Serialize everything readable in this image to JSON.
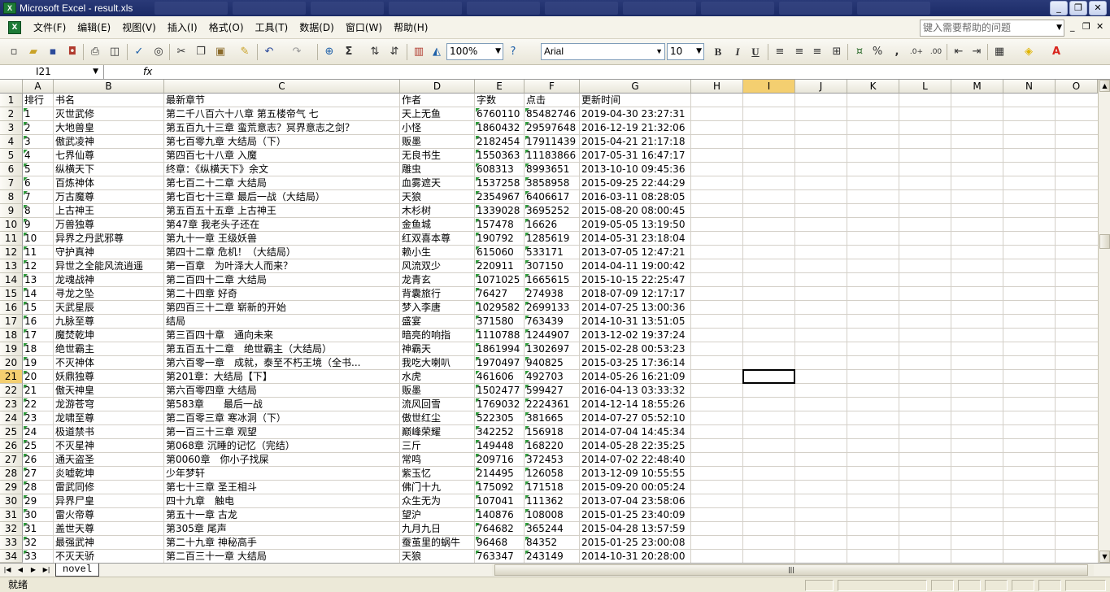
{
  "window": {
    "title": "Microsoft Excel - result.xls",
    "minimize": "_",
    "restore": "❐",
    "close": "✕"
  },
  "menu": {
    "items": [
      "文件(F)",
      "编辑(E)",
      "视图(V)",
      "插入(I)",
      "格式(O)",
      "工具(T)",
      "数据(D)",
      "窗口(W)",
      "帮助(H)"
    ],
    "help_placeholder": "键入需要帮助的问题",
    "doc_minimize": "_",
    "doc_restore": "❐",
    "doc_close": "✕"
  },
  "toolbar": {
    "zoom": "100%",
    "font_name": "Arial",
    "font_size": "10",
    "bold": "B",
    "italic": "I",
    "underline": "U",
    "percent": "%",
    "comma": ",",
    "sum": "Σ"
  },
  "formula": {
    "name_box": "I21",
    "fx_label": "fx",
    "value": ""
  },
  "columns": [
    "A",
    "B",
    "C",
    "D",
    "E",
    "F",
    "G",
    "H",
    "I",
    "J",
    "K",
    "L",
    "M",
    "N",
    "O"
  ],
  "rows": [
    [
      "排行",
      "书名",
      "最新章节",
      "作者",
      "字数",
      "点击",
      "更新时间"
    ],
    [
      "1",
      "灭世武修",
      "第二千八百六十八章 第五楼帝气 七",
      "天上无鱼",
      "6760110",
      "85482746",
      "2019-04-30 23:27:31"
    ],
    [
      "2",
      "大地兽皇",
      "第五百九十三章 蛮荒意志？冥界意志之剑？",
      "小怪",
      "1860432",
      "29597648",
      "2016-12-19 21:32:06"
    ],
    [
      "3",
      "傲武凌神",
      "第七百零九章 大结局（下）",
      "贩墨",
      "2182454",
      "17911439",
      "2015-04-21 21:17:18"
    ],
    [
      "4",
      "七界仙尊",
      "第四百七十八章 入魔",
      "无良书生",
      "1550363",
      "11183866",
      "2017-05-31 16:47:17"
    ],
    [
      "5",
      "纵横天下",
      "终章：《纵横天下》余文",
      "雕虫",
      "608313",
      "8993651",
      "2013-10-10 09:45:36"
    ],
    [
      "6",
      "百炼神体",
      "第七百二十二章 大结局",
      "血雾遮天",
      "1537258",
      "3858958",
      "2015-09-25 22:44:29"
    ],
    [
      "7",
      "万古魔尊",
      "第七百七十三章 最后一战（大结局）",
      "天狼",
      "2354967",
      "6406617",
      "2016-03-11 08:28:05"
    ],
    [
      "8",
      "上古神王",
      "第五百五十五章 上古神王",
      "木杉树",
      "1339028",
      "3695252",
      "2015-08-20 08:00:45"
    ],
    [
      "9",
      "万兽独尊",
      "第47章 我老头子还在",
      "金鱼城",
      "157478",
      "16626",
      "2019-05-05 13:19:50"
    ],
    [
      "10",
      "异界之丹武邪尊",
      "第九十一章 王级妖兽",
      "红双喜本尊",
      "190792",
      "1285619",
      "2014-05-31 23:18:04"
    ],
    [
      "11",
      "守护真神",
      "第四十二章 危机！（大结局）",
      "赖小生",
      "615060",
      "533171",
      "2013-07-05 12:47:21"
    ],
    [
      "12",
      "异世之全能风流逍遥",
      "第一百章　为叶泽大人而来？",
      "风流双少",
      "220911",
      "307150",
      "2014-04-11 19:00:42"
    ],
    [
      "13",
      "龙魂战神",
      "第二百四十二章 大结局",
      "龙青玄",
      "1071025",
      "1665615",
      "2015-10-15 22:25:47"
    ],
    [
      "14",
      "寻龙之坠",
      "第二十四章 好奇",
      "背囊旅行",
      "76427",
      "274938",
      "2018-07-09 12:17:17"
    ],
    [
      "15",
      "天武星辰",
      "第四百三十二章 崭新的开始",
      "梦入李唐",
      "1029582",
      "2699133",
      "2014-07-25 13:00:36"
    ],
    [
      "16",
      "九脉至尊",
      "结局",
      "盛宴",
      "371580",
      "763439",
      "2014-10-31 13:51:05"
    ],
    [
      "17",
      "魔焚乾坤",
      "第三百四十章　通向未来",
      "暗亮的响指",
      "1110788",
      "1244907",
      "2013-12-02 19:37:24"
    ],
    [
      "18",
      "绝世霸主",
      "第五百五十二章　绝世霸主（大结局）",
      "神霸天",
      "1861994",
      "1302697",
      "2015-02-28 00:53:23"
    ],
    [
      "19",
      "不灭神体",
      "第六百零一章　成就，泰至不朽王境（全书...",
      "我吃大喇叭",
      "1970497",
      "940825",
      "2015-03-25 17:36:14"
    ],
    [
      "20",
      "妖鼎独尊",
      "第201章：大结局【下】",
      "水虎",
      "461606",
      "492703",
      "2014-05-26 16:21:09"
    ],
    [
      "21",
      "傲天神皇",
      "第六百零四章 大结局",
      "贩墨",
      "1502477",
      "599427",
      "2016-04-13 03:33:32"
    ],
    [
      "22",
      "龙游苍穹",
      "第583章　　最后一战",
      "流风回雪",
      "1769032",
      "2224361",
      "2014-12-14 18:55:26"
    ],
    [
      "23",
      "龙啸至尊",
      "第二百零三章 寒冰洞（下）",
      "傲世红尘",
      "522305",
      "381665",
      "2014-07-27 05:52:10"
    ],
    [
      "24",
      "极道禁书",
      "第一百三十三章 观望",
      "巅峰荣耀",
      "342252",
      "156918",
      "2014-07-04 14:45:34"
    ],
    [
      "25",
      "不灭星神",
      "第068章 沉睡的记忆（完结）",
      "三斤",
      "149448",
      "168220",
      "2014-05-28 22:35:25"
    ],
    [
      "26",
      "通天盗圣",
      "第0060章　你小子找屎",
      "常鸣",
      "209716",
      "372453",
      "2014-07-02 22:48:40"
    ],
    [
      "27",
      "炎嘘乾坤",
      "少年梦轩",
      "紫玉忆",
      "214495",
      "126058",
      "2013-12-09 10:55:55"
    ],
    [
      "28",
      "雷武同修",
      "第七十三章 圣王相斗",
      "佛门十九",
      "175092",
      "171518",
      "2015-09-20 00:05:24"
    ],
    [
      "29",
      "异界尸皇",
      "四十九章　触电",
      "众生无为",
      "107041",
      "111362",
      "2013-07-04 23:58:06"
    ],
    [
      "30",
      "雷火帝尊",
      "第五十一章 古龙",
      "望沪",
      "140876",
      "108008",
      "2015-01-25 23:40:09"
    ],
    [
      "31",
      "盖世天尊",
      "第305章 尾声",
      "九月九日",
      "764682",
      "365244",
      "2015-04-28 13:57:59"
    ],
    [
      "32",
      "最强武神",
      "第二十九章 神秘高手",
      "蚕茧里的蜗牛",
      "96468",
      "84352",
      "2015-01-25 23:00:08"
    ],
    [
      "33",
      "不灭天骄",
      "第二百三十一章 大结局",
      "天狼",
      "763347",
      "243149",
      "2014-10-31 20:28:00"
    ]
  ],
  "sheet": {
    "tab": "novel",
    "nav_first": "|◀",
    "nav_prev": "◀",
    "nav_next": "▶",
    "nav_last": "▶|"
  },
  "status": {
    "text": "就绪"
  }
}
